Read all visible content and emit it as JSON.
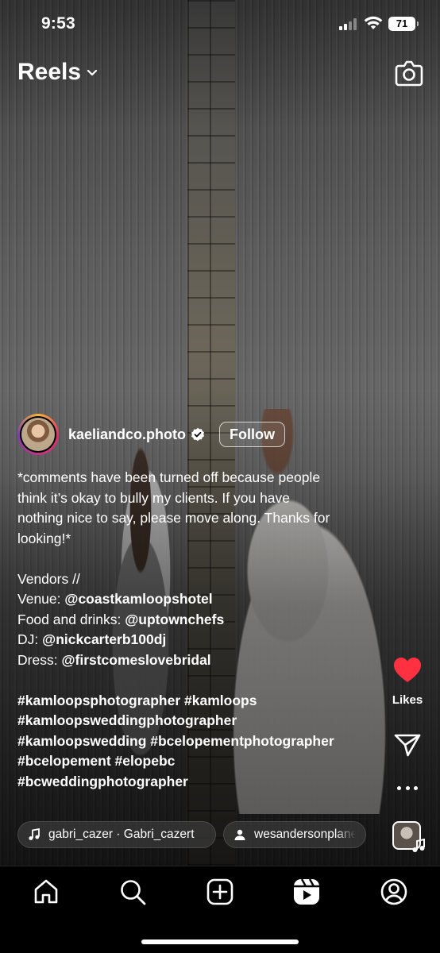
{
  "status_bar": {
    "time": "9:53",
    "battery": "71"
  },
  "header": {
    "title": "Reels"
  },
  "post": {
    "username": "kaeliandco.photo",
    "follow_label": "Follow",
    "caption_lines": [
      "*comments have been turned off because people",
      "think it’s okay to bully my clients. If you have",
      "nothing nice to say, please move along. Thanks for",
      "looking!*"
    ],
    "vendors_heading": "Vendors //",
    "vendors": [
      {
        "label": "Venue:",
        "handle": "@coastkamloopshotel"
      },
      {
        "label": "Food and drinks:",
        "handle": "@uptownchefs"
      },
      {
        "label": "DJ:",
        "handle": "@nickcarterb100dj"
      },
      {
        "label": "Dress:",
        "handle": "@firstcomeslovebridal"
      }
    ],
    "hashtag_lines": [
      "#kamloopsphotographer #kamloops",
      "#kamloopsweddingphotographer",
      "#kamloopswedding #bcelopementphotographer",
      "#bcelopement #elopebc",
      "#bcweddingphotographer"
    ],
    "audio_label": "gabri_cazer · Gabri_cazert",
    "tagged_user": "wesandersonplanet"
  },
  "actions": {
    "likes_label": "Likes"
  },
  "colors": {
    "heart": "#ff3040",
    "background": "#000000"
  },
  "icons": {
    "header": [
      "chevron-down-icon",
      "camera-icon"
    ],
    "rail": [
      "heart-icon",
      "send-icon",
      "more-icon",
      "audio-icon"
    ],
    "nav": [
      "home-icon",
      "search-icon",
      "create-icon",
      "reels-icon",
      "profile-icon"
    ]
  }
}
